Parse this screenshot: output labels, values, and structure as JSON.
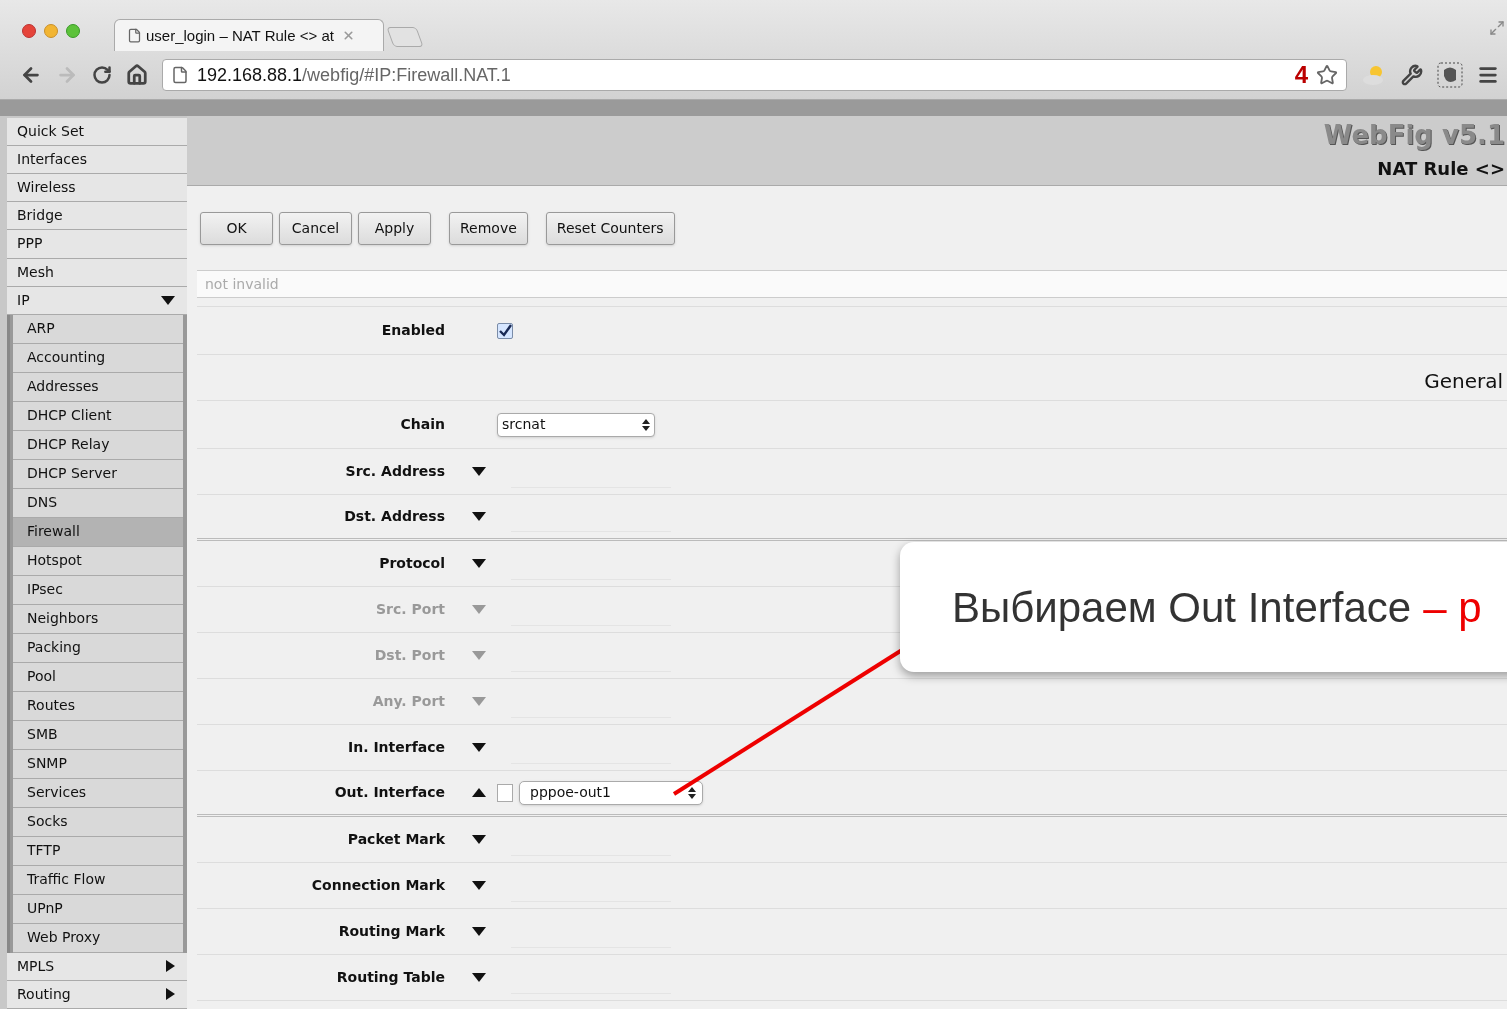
{
  "browser": {
    "tab_title": "user_login – NAT Rule <> at",
    "url_host": "192.168.88.1",
    "url_path": "/webfig/#IP:Firewall.NAT.1",
    "badge": "4"
  },
  "sidebar": {
    "items": [
      {
        "label": "Quick Set",
        "selected": false
      },
      {
        "label": "Interfaces",
        "selected": false
      },
      {
        "label": "Wireless",
        "selected": false
      },
      {
        "label": "Bridge",
        "selected": false
      },
      {
        "label": "PPP",
        "selected": false
      },
      {
        "label": "Mesh",
        "selected": false
      },
      {
        "label": "IP",
        "selected": false,
        "expanded": true,
        "children": [
          {
            "label": "ARP",
            "selected": false
          },
          {
            "label": "Accounting",
            "selected": false
          },
          {
            "label": "Addresses",
            "selected": false
          },
          {
            "label": "DHCP Client",
            "selected": false
          },
          {
            "label": "DHCP Relay",
            "selected": false
          },
          {
            "label": "DHCP Server",
            "selected": false
          },
          {
            "label": "DNS",
            "selected": false
          },
          {
            "label": "Firewall",
            "selected": true
          },
          {
            "label": "Hotspot",
            "selected": false
          },
          {
            "label": "IPsec",
            "selected": false
          },
          {
            "label": "Neighbors",
            "selected": false
          },
          {
            "label": "Packing",
            "selected": false
          },
          {
            "label": "Pool",
            "selected": false
          },
          {
            "label": "Routes",
            "selected": false
          },
          {
            "label": "SMB",
            "selected": false
          },
          {
            "label": "SNMP",
            "selected": false
          },
          {
            "label": "Services",
            "selected": false
          },
          {
            "label": "Socks",
            "selected": false
          },
          {
            "label": "TFTP",
            "selected": false
          },
          {
            "label": "Traffic Flow",
            "selected": false
          },
          {
            "label": "UPnP",
            "selected": false
          },
          {
            "label": "Web Proxy",
            "selected": false
          }
        ]
      },
      {
        "label": "MPLS",
        "selected": false,
        "expanded": false
      },
      {
        "label": "Routing",
        "selected": false,
        "expanded": false
      }
    ]
  },
  "header": {
    "app_title": "WebFig v5.1",
    "page_title": "NAT Rule <>"
  },
  "buttons": [
    "OK",
    "Cancel",
    "Apply",
    "Remove",
    "Reset Counters"
  ],
  "status_field": {
    "placeholder": "not invalid"
  },
  "form": [
    {
      "kind": "checkbox",
      "label": "Enabled",
      "checked": true
    },
    {
      "kind": "section",
      "label": "General"
    },
    {
      "kind": "select",
      "label": "Chain",
      "value": "srcnat"
    },
    {
      "kind": "toggle",
      "label": "Src. Address",
      "expanded": false,
      "disabled": false
    },
    {
      "kind": "toggle",
      "label": "Dst. Address",
      "expanded": false,
      "disabled": false,
      "group_end": true
    },
    {
      "kind": "toggle",
      "label": "Protocol",
      "expanded": false,
      "disabled": false
    },
    {
      "kind": "toggle",
      "label": "Src. Port",
      "expanded": false,
      "disabled": true
    },
    {
      "kind": "toggle",
      "label": "Dst. Port",
      "expanded": false,
      "disabled": true
    },
    {
      "kind": "toggle",
      "label": "Any. Port",
      "expanded": false,
      "disabled": true
    },
    {
      "kind": "toggle",
      "label": "In. Interface",
      "expanded": false,
      "disabled": false
    },
    {
      "kind": "toggle",
      "label": "Out. Interface",
      "expanded": true,
      "disabled": false,
      "inverted": false,
      "value": "pppoe-out1",
      "group_end": true
    },
    {
      "kind": "toggle",
      "label": "Packet Mark",
      "expanded": false,
      "disabled": false
    },
    {
      "kind": "toggle",
      "label": "Connection Mark",
      "expanded": false,
      "disabled": false
    },
    {
      "kind": "toggle",
      "label": "Routing Mark",
      "expanded": false,
      "disabled": false
    },
    {
      "kind": "toggle",
      "label": "Routing Table",
      "expanded": false,
      "disabled": false
    }
  ],
  "callout": {
    "text": "Выбираем Out Interface",
    "accent": "– р"
  }
}
